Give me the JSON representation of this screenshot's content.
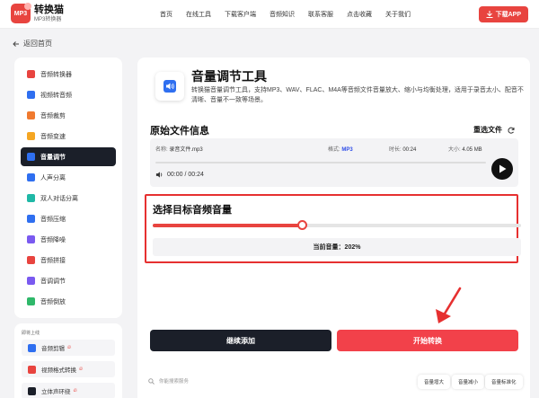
{
  "header": {
    "logo_badge": "MP3",
    "logo_name": "转换猫",
    "logo_sub": "MP3转换器",
    "nav": [
      "首页",
      "在线工具",
      "下载客户端",
      "音频知识",
      "联系客服",
      "点击收藏",
      "关于我们"
    ],
    "download_app": "下载APP"
  },
  "back_label": "返回首页",
  "sidebar": {
    "items": [
      {
        "label": "音频转换器",
        "color": "#e8443f"
      },
      {
        "label": "视频转音频",
        "color": "#2f6ff0"
      },
      {
        "label": "音频裁剪",
        "color": "#f07a2f"
      },
      {
        "label": "音频变速",
        "color": "#f5a623"
      },
      {
        "label": "音量调节",
        "color": "#2f6ff0",
        "active": true
      },
      {
        "label": "人声分离",
        "color": "#2f6ff0"
      },
      {
        "label": "双人对话分离",
        "color": "#1fb8a6"
      },
      {
        "label": "音频压缩",
        "color": "#2f6ff0"
      },
      {
        "label": "音频降噪",
        "color": "#7a5af0"
      },
      {
        "label": "音频拼接",
        "color": "#e8443f"
      },
      {
        "label": "音调调节",
        "color": "#7a5af0"
      },
      {
        "label": "音频倒放",
        "color": "#2fb86a"
      }
    ],
    "new_title": "即将上线",
    "new_items": [
      "音频剪辑",
      "视频格式转换",
      "立体声环绕"
    ]
  },
  "tool": {
    "title": "音量调节工具",
    "desc": "转换猫音量调节工具，支持MP3、WAV、FLAC、M4A等音频文件音量放大、缩小与均衡处理，适用于录音太小、配音不清晰、音量不一致等场景。"
  },
  "original": {
    "title": "原始文件信息",
    "reselect": "重选文件",
    "name_label": "名称:",
    "name_value": "录音文件.mp3",
    "format_label": "格式:",
    "format_value": "MP3",
    "duration_label": "时长:",
    "duration_value": "00:24",
    "size_label": "大小:",
    "size_value": "4.05 MB",
    "time_display": "00:00 / 00:24",
    "progress": 0
  },
  "target": {
    "title": "选择目标音频音量",
    "slider_fraction": 0.405,
    "current_label": "当前音量：202%"
  },
  "actions": {
    "continue_add": "继续添加",
    "start_convert": "开始转换"
  },
  "bottom": {
    "search_placeholder": "你能搜索服务",
    "tags": [
      "音量增大",
      "音量减小",
      "音量标准化"
    ]
  },
  "colors": {
    "accent": "#e8443f",
    "dark": "#1b1f29",
    "highlight_border": "#e63030",
    "format_blue": "#2f4ee8"
  }
}
